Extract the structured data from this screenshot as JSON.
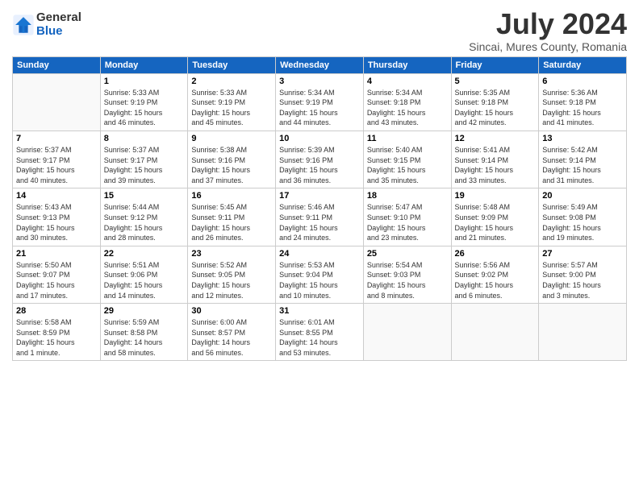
{
  "header": {
    "logo_general": "General",
    "logo_blue": "Blue",
    "month_title": "July 2024",
    "location": "Sincai, Mures County, Romania"
  },
  "days_of_week": [
    "Sunday",
    "Monday",
    "Tuesday",
    "Wednesday",
    "Thursday",
    "Friday",
    "Saturday"
  ],
  "weeks": [
    [
      {
        "day": "",
        "info": ""
      },
      {
        "day": "1",
        "info": "Sunrise: 5:33 AM\nSunset: 9:19 PM\nDaylight: 15 hours\nand 46 minutes."
      },
      {
        "day": "2",
        "info": "Sunrise: 5:33 AM\nSunset: 9:19 PM\nDaylight: 15 hours\nand 45 minutes."
      },
      {
        "day": "3",
        "info": "Sunrise: 5:34 AM\nSunset: 9:19 PM\nDaylight: 15 hours\nand 44 minutes."
      },
      {
        "day": "4",
        "info": "Sunrise: 5:34 AM\nSunset: 9:18 PM\nDaylight: 15 hours\nand 43 minutes."
      },
      {
        "day": "5",
        "info": "Sunrise: 5:35 AM\nSunset: 9:18 PM\nDaylight: 15 hours\nand 42 minutes."
      },
      {
        "day": "6",
        "info": "Sunrise: 5:36 AM\nSunset: 9:18 PM\nDaylight: 15 hours\nand 41 minutes."
      }
    ],
    [
      {
        "day": "7",
        "info": "Sunrise: 5:37 AM\nSunset: 9:17 PM\nDaylight: 15 hours\nand 40 minutes."
      },
      {
        "day": "8",
        "info": "Sunrise: 5:37 AM\nSunset: 9:17 PM\nDaylight: 15 hours\nand 39 minutes."
      },
      {
        "day": "9",
        "info": "Sunrise: 5:38 AM\nSunset: 9:16 PM\nDaylight: 15 hours\nand 37 minutes."
      },
      {
        "day": "10",
        "info": "Sunrise: 5:39 AM\nSunset: 9:16 PM\nDaylight: 15 hours\nand 36 minutes."
      },
      {
        "day": "11",
        "info": "Sunrise: 5:40 AM\nSunset: 9:15 PM\nDaylight: 15 hours\nand 35 minutes."
      },
      {
        "day": "12",
        "info": "Sunrise: 5:41 AM\nSunset: 9:14 PM\nDaylight: 15 hours\nand 33 minutes."
      },
      {
        "day": "13",
        "info": "Sunrise: 5:42 AM\nSunset: 9:14 PM\nDaylight: 15 hours\nand 31 minutes."
      }
    ],
    [
      {
        "day": "14",
        "info": "Sunrise: 5:43 AM\nSunset: 9:13 PM\nDaylight: 15 hours\nand 30 minutes."
      },
      {
        "day": "15",
        "info": "Sunrise: 5:44 AM\nSunset: 9:12 PM\nDaylight: 15 hours\nand 28 minutes."
      },
      {
        "day": "16",
        "info": "Sunrise: 5:45 AM\nSunset: 9:11 PM\nDaylight: 15 hours\nand 26 minutes."
      },
      {
        "day": "17",
        "info": "Sunrise: 5:46 AM\nSunset: 9:11 PM\nDaylight: 15 hours\nand 24 minutes."
      },
      {
        "day": "18",
        "info": "Sunrise: 5:47 AM\nSunset: 9:10 PM\nDaylight: 15 hours\nand 23 minutes."
      },
      {
        "day": "19",
        "info": "Sunrise: 5:48 AM\nSunset: 9:09 PM\nDaylight: 15 hours\nand 21 minutes."
      },
      {
        "day": "20",
        "info": "Sunrise: 5:49 AM\nSunset: 9:08 PM\nDaylight: 15 hours\nand 19 minutes."
      }
    ],
    [
      {
        "day": "21",
        "info": "Sunrise: 5:50 AM\nSunset: 9:07 PM\nDaylight: 15 hours\nand 17 minutes."
      },
      {
        "day": "22",
        "info": "Sunrise: 5:51 AM\nSunset: 9:06 PM\nDaylight: 15 hours\nand 14 minutes."
      },
      {
        "day": "23",
        "info": "Sunrise: 5:52 AM\nSunset: 9:05 PM\nDaylight: 15 hours\nand 12 minutes."
      },
      {
        "day": "24",
        "info": "Sunrise: 5:53 AM\nSunset: 9:04 PM\nDaylight: 15 hours\nand 10 minutes."
      },
      {
        "day": "25",
        "info": "Sunrise: 5:54 AM\nSunset: 9:03 PM\nDaylight: 15 hours\nand 8 minutes."
      },
      {
        "day": "26",
        "info": "Sunrise: 5:56 AM\nSunset: 9:02 PM\nDaylight: 15 hours\nand 6 minutes."
      },
      {
        "day": "27",
        "info": "Sunrise: 5:57 AM\nSunset: 9:00 PM\nDaylight: 15 hours\nand 3 minutes."
      }
    ],
    [
      {
        "day": "28",
        "info": "Sunrise: 5:58 AM\nSunset: 8:59 PM\nDaylight: 15 hours\nand 1 minute."
      },
      {
        "day": "29",
        "info": "Sunrise: 5:59 AM\nSunset: 8:58 PM\nDaylight: 14 hours\nand 58 minutes."
      },
      {
        "day": "30",
        "info": "Sunrise: 6:00 AM\nSunset: 8:57 PM\nDaylight: 14 hours\nand 56 minutes."
      },
      {
        "day": "31",
        "info": "Sunrise: 6:01 AM\nSunset: 8:55 PM\nDaylight: 14 hours\nand 53 minutes."
      },
      {
        "day": "",
        "info": ""
      },
      {
        "day": "",
        "info": ""
      },
      {
        "day": "",
        "info": ""
      }
    ]
  ]
}
